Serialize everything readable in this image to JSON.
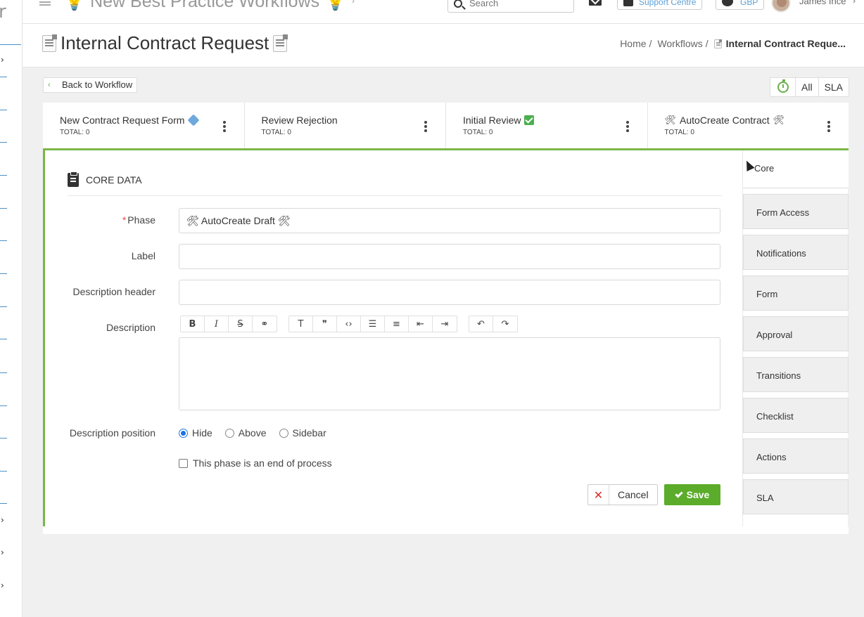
{
  "topbar": {
    "title": "💡 New Best Practice Workflows 💡",
    "search_placeholder": "Search",
    "support_label": "Support Centre",
    "currency_label": "GBP",
    "user_name": "James Ince"
  },
  "sidebar": {
    "letter": "r"
  },
  "page": {
    "title": "Internal Contract Request",
    "breadcrumb": {
      "home": "Home",
      "workflows": "Workflows",
      "current": "Internal Contract Reque..."
    }
  },
  "controls": {
    "back_label": "Back to Workflow",
    "filter_all": "All",
    "filter_sla": "SLA"
  },
  "phases": [
    {
      "title": "New Contract Request Form",
      "total": "TOTAL: 0"
    },
    {
      "title": "Review Rejection",
      "total": "TOTAL: 0"
    },
    {
      "title": "Initial Review",
      "total": "TOTAL: 0"
    },
    {
      "title": "AutoCreate Contract",
      "total": "TOTAL: 0"
    }
  ],
  "form": {
    "section_title": "CORE DATA",
    "phase_label": "Phase",
    "phase_value": "🛠 AutoCreate Draft 🛠",
    "label_label": "Label",
    "label_value": "",
    "desc_header_label": "Description header",
    "desc_header_value": "",
    "description_label": "Description",
    "desc_position_label": "Description position",
    "position_options": [
      "Hide",
      "Above",
      "Sidebar"
    ],
    "position_selected": "Hide",
    "end_process_label": "This phase is an end of process",
    "end_process_checked": false,
    "cancel_label": "Cancel",
    "save_label": "Save"
  },
  "tabs": [
    "Core",
    "Form Access",
    "Notifications",
    "Form",
    "Approval",
    "Transitions",
    "Checklist",
    "Actions",
    "SLA"
  ],
  "colors": {
    "accent_green": "#7ab648",
    "save_green": "#5aac2a",
    "link_blue": "#5a9fd4",
    "cancel_red": "#d9302c"
  }
}
